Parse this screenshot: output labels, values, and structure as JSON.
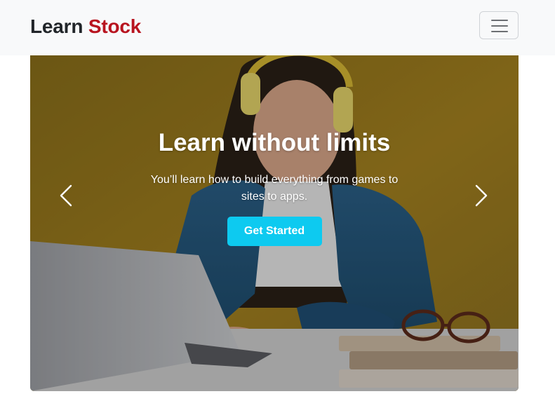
{
  "navbar": {
    "brand_first": "Learn",
    "brand_second": "Stock",
    "toggler_icon": "hamburger-icon"
  },
  "hero": {
    "title": "Learn without limits",
    "description": "You’ll learn how to build everything from games to sites to apps.",
    "cta_label": "Get Started",
    "prev_icon": "chevron-left-icon",
    "next_icon": "chevron-right-icon"
  },
  "colors": {
    "brand_accent": "#b8141f",
    "cta": "#0dcaf0",
    "navbar_bg": "#f8f9fa"
  }
}
